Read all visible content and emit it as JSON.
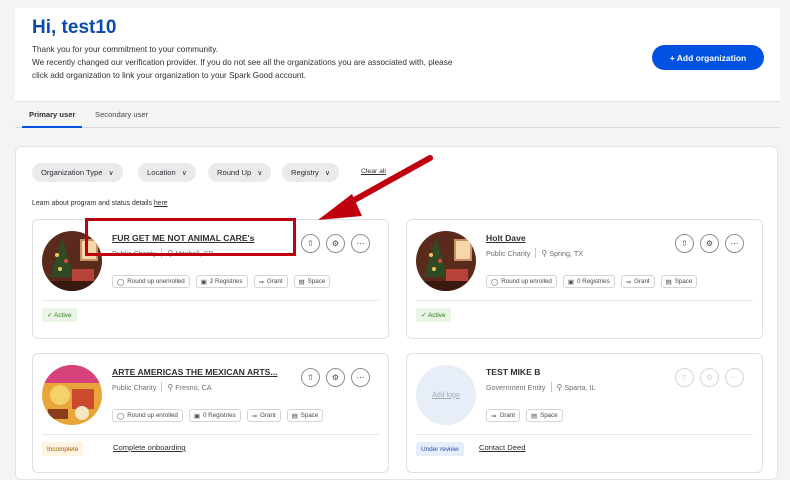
{
  "header": {
    "greeting": "Hi, test10",
    "intro_line1": "Thank you for your commitment to your community.",
    "intro_line2": "We recently changed our verification provider. If you do not see all the organizations you are associated with, please",
    "intro_line3": "click add organization to link your organization to your Spark Good account.",
    "add_button": "+ Add organization"
  },
  "tabs": [
    {
      "label": "Primary user",
      "selected": true
    },
    {
      "label": "Secondary user",
      "selected": false
    }
  ],
  "filters": {
    "items": [
      "Organization Type",
      "Location",
      "Round Up",
      "Registry"
    ],
    "clear_all": "Clear all"
  },
  "learn": {
    "text": "Learn about program and status details",
    "link": "here"
  },
  "organizations": [
    {
      "name": "FUR GET ME NOT ANIMAL CARE's",
      "type": "Public Charity",
      "location": "Mitchell, SD",
      "roundup": "Round up unenrolled",
      "registries": "2 Registries",
      "grant": "Grant",
      "space": "Space",
      "status": "Active",
      "status_link": ""
    },
    {
      "name": "Holt Dave",
      "type": "Public Charity",
      "location": "Spring, TX",
      "roundup": "Round up enrolled",
      "registries": "0 Registries",
      "grant": "Grant",
      "space": "Space",
      "status": "Active",
      "status_link": ""
    },
    {
      "name": "ARTE AMERICAS THE MEXICAN ARTS...",
      "type": "Public Charity",
      "location": "Fresno, CA",
      "roundup": "Round up enrolled",
      "registries": "0 Registries",
      "grant": "Grant",
      "space": "Space",
      "status": "Incomplete",
      "status_link": "Complete onboarding"
    },
    {
      "name": "TEST MIKE B",
      "type": "Government Entity",
      "location": "Sparta, IL",
      "add_logo": "Add logo",
      "grant": "Grant",
      "space": "Space",
      "status": "Under review",
      "status_link": "Contact Deed"
    }
  ],
  "colors": {
    "accent": "#0053e2",
    "greeting": "#0b4bb0",
    "annotation": "#c0000f"
  }
}
